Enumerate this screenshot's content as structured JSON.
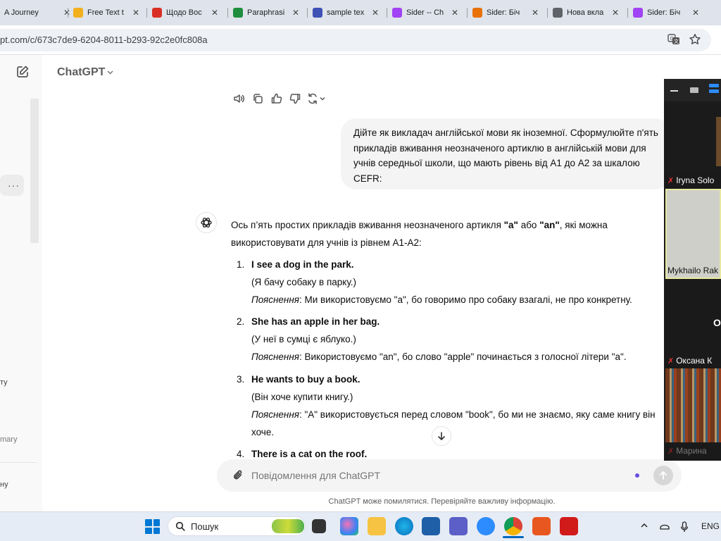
{
  "browser": {
    "tabs": [
      {
        "label": "A Journey",
        "color": "#888888"
      },
      {
        "label": "Free Text t",
        "color": "#f2b01e"
      },
      {
        "label": "Щодо Вос",
        "color": "#d93025"
      },
      {
        "label": "Paraphrasi",
        "color": "#1e8e3e"
      },
      {
        "label": "sample tex",
        "color": "#3f51b5"
      },
      {
        "label": "Sider -- Ch",
        "color": "#a142f4"
      },
      {
        "label": "Sider: Біч",
        "color": "#e8710a"
      },
      {
        "label": "Нова вкла",
        "color": "#5f6368"
      },
      {
        "label": "Sider: Біч",
        "color": "#a142f4"
      }
    ],
    "url": "pt.com/c/673c7de9-6204-8011-b293-92c2e0fc808a"
  },
  "sidebar": {
    "fragments": [
      "ту",
      "mary",
      "ну"
    ]
  },
  "header": {
    "model": "ChatGPT"
  },
  "conversation": {
    "user_message": "Дійте як викладач англійської мови як іноземної. Сформулюйте п'ять прикладів вживання неозначеного артиклю в англійській мови для учнів середньої школи, що мають рівень від А1 до А2 за шкалою CEFR:",
    "intro_1": "Ось п’ять простих прикладів вживання неозначеного артикля ",
    "intro_a": "\"a\"",
    "intro_or": " або ",
    "intro_an": "\"an\"",
    "intro_2": ", які можна",
    "intro_line2": "використовувати для учнів із рівнем A1-A2:",
    "explain_label": "Пояснення",
    "items": [
      {
        "num": "1.",
        "sentence": "I see a dog in the park.",
        "translation": "(Я бачу собаку в парку.)",
        "explanation": ": Ми використовуємо \"a\", бо говоримо про собаку взагалі, не про конкретну."
      },
      {
        "num": "2.",
        "sentence": "She has an apple in her bag.",
        "translation": "(У неї в сумці є яблуко.)",
        "explanation": ": Використовуємо \"an\", бо слово \"apple\" починається з голосної літери \"a\"."
      },
      {
        "num": "3.",
        "sentence": "He wants to buy a book.",
        "translation": "(Він хоче купити книгу.)",
        "explanation": ": \"A\" використовується перед словом \"book\", бо ми не знаємо, яку саме книгу він",
        "explanation_2": "хоче."
      },
      {
        "num": "4.",
        "sentence": "There is a cat on the roof."
      }
    ]
  },
  "composer": {
    "placeholder": "Повідомлення для ChatGPT",
    "disclaimer": "ChatGPT може помилятися. Перевіряйте важливу інформацію."
  },
  "video_call": {
    "participants": [
      {
        "name": "Iryna Solo"
      },
      {
        "name": "Mykhailo Rak"
      },
      {
        "name": "O"
      },
      {
        "name": "Оксана К"
      },
      {
        "name": "Марина"
      }
    ]
  },
  "taskbar": {
    "search_label": "Пошук",
    "language": "ENG"
  }
}
